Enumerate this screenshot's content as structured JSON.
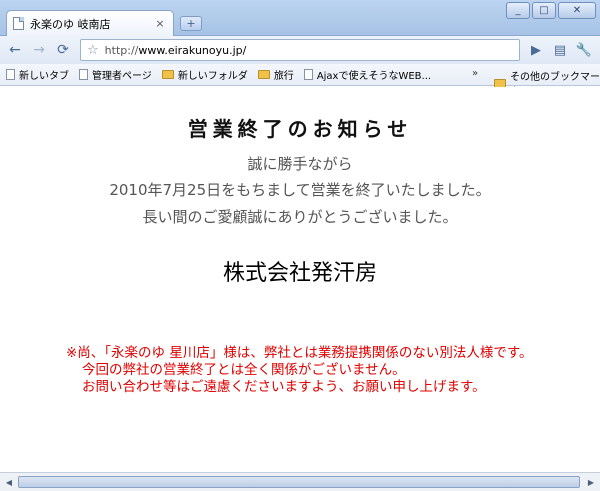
{
  "window": {
    "tab_title": "永楽のゆ 岐南店",
    "tab_close": "×",
    "new_tab": "+",
    "controls": {
      "minimize": "_",
      "maximize": "□",
      "close": "✕"
    }
  },
  "toolbar": {
    "back": "←",
    "forward": "→",
    "reload": "⟳",
    "url_prefix": "http://",
    "url_host": "www.eirakunoyu.jp/",
    "go": "▶",
    "page_menu": "▤",
    "tools_menu": "🔧"
  },
  "bookmarks": {
    "items": [
      {
        "label": "新しいタブ",
        "type": "page"
      },
      {
        "label": "管理者ページ",
        "type": "page"
      },
      {
        "label": "新しいフォルダ",
        "type": "folder"
      },
      {
        "label": "旅行",
        "type": "folder"
      },
      {
        "label": "Ajaxで使えそうなWEB...",
        "type": "page"
      }
    ],
    "more": "»",
    "other": "その他のブックマーク"
  },
  "content": {
    "heading": "営業終了のお知らせ",
    "message_lines": [
      "誠に勝手ながら",
      "2010年7月25日をもちまして営業を終了いたしました。",
      "長い間のご愛顧誠にありがとうございました。"
    ],
    "company": "株式会社発汗房",
    "notice_lines": [
      "※尚、「永楽のゆ 星川店」様は、弊社とは業務提携関係のない別法人様です。",
      "今回の弊社の営業終了とは全く関係がございません。",
      "お問い合わせ等はご遠慮くださいますよう、お願い申し上げます。"
    ]
  },
  "scrollbar": {
    "left": "◀",
    "right": "▶"
  }
}
